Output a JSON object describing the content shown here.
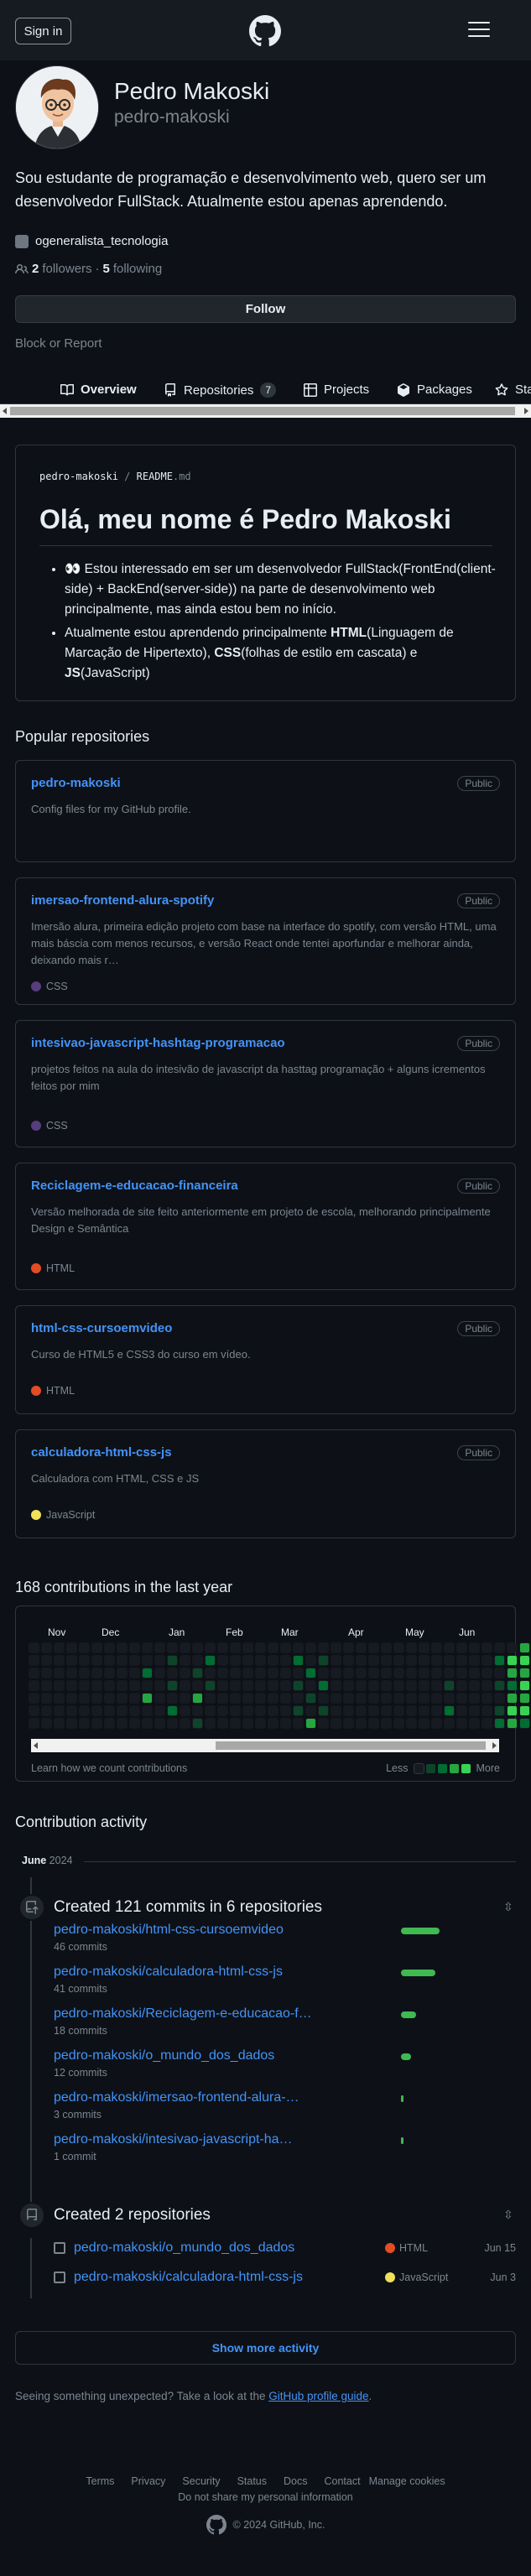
{
  "header": {
    "signin_label": "Sign in"
  },
  "profile": {
    "name": "Pedro Makoski",
    "login": "pedro-makoski",
    "bio": "Sou estudante de programação e desenvolvimento web, quero ser um desenvolvedor FullStack. Atualmente estou apenas aprendendo.",
    "org": "ogeneralista_tecnologia",
    "followers_count": "2",
    "followers_label": "followers",
    "separator": "·",
    "following_count": "5",
    "following_label": "following",
    "follow_label": "Follow",
    "block_label": "Block or Report"
  },
  "tabs": [
    {
      "label": "Overview",
      "icon": "book-icon",
      "active": true
    },
    {
      "label": "Repositories",
      "icon": "repo-icon",
      "count": "7"
    },
    {
      "label": "Projects",
      "icon": "table-icon"
    },
    {
      "label": "Packages",
      "icon": "package-icon"
    },
    {
      "label": "Sta",
      "icon": "star-icon"
    }
  ],
  "readme": {
    "path_owner": "pedro-makoski",
    "path_sep": "/",
    "path_file": "README",
    "path_ext": ".md",
    "title": "Olá, meu nome é Pedro Makoski",
    "item1_emoji": "👀",
    "item1_text": "Estou interessado em ser um desenvolvedor FullStack(FrontEnd(client-side) + BackEnd(server-side)) na parte de desenvolvimento web principalmente, mas ainda estou bem no início.",
    "item2_a": "Atualmente estou aprendendo principalmente ",
    "item2_html": "HTML",
    "item2_b": "(Linguagem de Marcação de Hipertexto), ",
    "item2_css": "CSS",
    "item2_c": "(folhas de estilo em cascata) e ",
    "item2_js": "JS",
    "item2_d": "(JavaScript)"
  },
  "popular": {
    "title": "Popular repositories",
    "badge": "Public",
    "repos": [
      {
        "name": "pedro-makoski",
        "desc": "Config files for my GitHub profile.",
        "lang": "",
        "color": ""
      },
      {
        "name": "imersao-frontend-alura-spotify",
        "desc": "Imersão alura, primeira edição projeto com base na interface do spotify, com versão HTML, uma mais báscia com menos recursos, e versão React onde tentei aporfundar e melhorar ainda, deixando mais r…",
        "lang": "CSS",
        "color": "#563d7c"
      },
      {
        "name": "intesivao-javascript-hashtag-programacao",
        "desc": "projetos feitos na aula do intesivão de javascript da hasttag programação + alguns icrementos feitos por mim",
        "lang": "CSS",
        "color": "#563d7c"
      },
      {
        "name": "Reciclagem-e-educacao-financeira",
        "desc": "Versão melhorada de site feito anteriormente em projeto de escola, melhorando principalmente Design e Semântica",
        "lang": "HTML",
        "color": "#e34c26"
      },
      {
        "name": "html-css-cursoemvideo",
        "desc": "Curso de HTML5 e CSS3 do curso em vídeo.",
        "lang": "HTML",
        "color": "#e34c26"
      },
      {
        "name": "calculadora-html-css-js",
        "desc": "Calculadora com HTML, CSS e JS",
        "lang": "JavaScript",
        "color": "#f1e05a"
      }
    ]
  },
  "contributions": {
    "title": "168 contributions in the last year",
    "months": [
      "Nov",
      "Dec",
      "Jan",
      "Feb",
      "Mar",
      "Apr",
      "May",
      "Jun"
    ],
    "learn": "Learn how we count contributions",
    "less": "Less",
    "more": "More",
    "colors": [
      "#161b22",
      "#0e4429",
      "#006d32",
      "#26a641",
      "#39d353"
    ]
  },
  "activity": {
    "title": "Contribution activity",
    "month": "June",
    "year": "2024",
    "commits_heading": "Created 121 commits in 6 repositories",
    "commits": [
      {
        "repo": "pedro-makoski/html-css-cursoemvideo",
        "count": "46 commits",
        "share": 0.92
      },
      {
        "repo": "pedro-makoski/calculadora-html-css-js",
        "count": "41 commits",
        "share": 0.82
      },
      {
        "repo": "pedro-makoski/Reciclagem-e-educacao-f…",
        "count": "18 commits",
        "share": 0.36
      },
      {
        "repo": "pedro-makoski/o_mundo_dos_dados",
        "count": "12 commits",
        "share": 0.24
      },
      {
        "repo": "pedro-makoski/imersao-frontend-alura-…",
        "count": "3 commits",
        "share": 0.06
      },
      {
        "repo": "pedro-makoski/intesivao-javascript-ha…",
        "count": "1 commit",
        "share": 0.02
      }
    ],
    "created_heading": "Created 2 repositories",
    "created": [
      {
        "repo": "pedro-makoski/o_mundo_dos_dados",
        "lang": "HTML",
        "color": "#e34c26",
        "date": "Jun 15"
      },
      {
        "repo": "pedro-makoski/calculadora-html-css-js",
        "lang": "JavaScript",
        "color": "#f1e05a",
        "date": "Jun 3"
      }
    ],
    "show_more": "Show more activity",
    "unexpected_a": "Seeing something unexpected? Take a look at the ",
    "unexpected_link": "GitHub profile guide",
    "unexpected_b": "."
  },
  "footer": {
    "links": [
      "Terms",
      "Privacy",
      "Security",
      "Status",
      "Docs",
      "Contact",
      "Manage cookies"
    ],
    "do_not_share": "Do not share my personal information",
    "copyright": "© 2024 GitHub, Inc."
  }
}
